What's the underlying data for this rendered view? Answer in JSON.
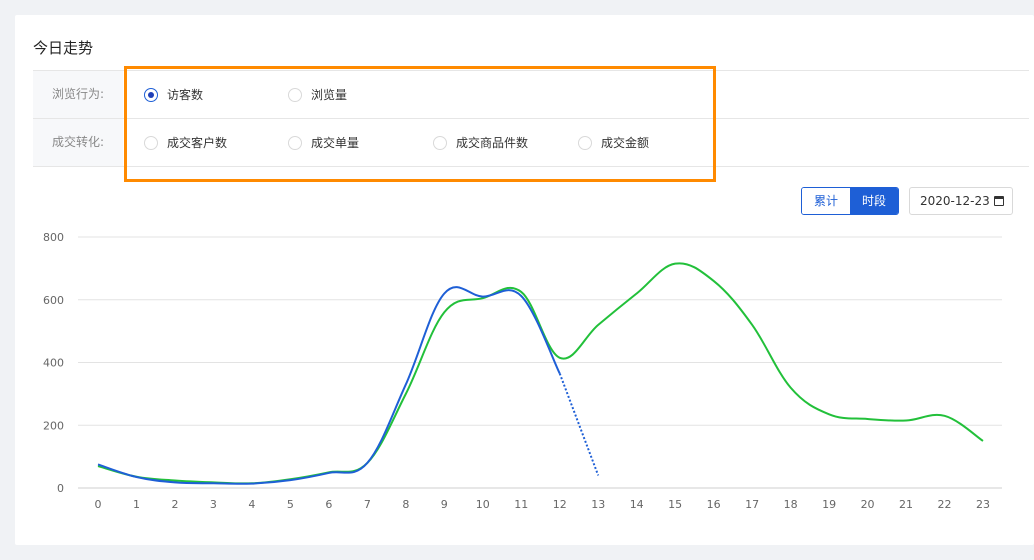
{
  "title": "今日走势",
  "filters": {
    "browse": {
      "label": "浏览行为:",
      "options": [
        {
          "label": "访客数",
          "checked": true
        },
        {
          "label": "浏览量",
          "checked": false
        }
      ]
    },
    "deal": {
      "label": "成交转化:",
      "options": [
        {
          "label": "成交客户数",
          "checked": false
        },
        {
          "label": "成交单量",
          "checked": false
        },
        {
          "label": "成交商品件数",
          "checked": false
        },
        {
          "label": "成交金额",
          "checked": false
        }
      ]
    }
  },
  "toggle": {
    "cumulative": "累计",
    "period": "时段",
    "active": "period"
  },
  "date": "2020-12-23",
  "colors": {
    "accent": "#1e5fd6",
    "highlight": "#ff8a00",
    "today": "#1e5fd6",
    "compare": "#22c03a"
  },
  "chart_data": {
    "type": "line",
    "x": [
      0,
      1,
      2,
      3,
      4,
      5,
      6,
      7,
      8,
      9,
      10,
      11,
      12,
      13,
      14,
      15,
      16,
      17,
      18,
      19,
      20,
      21,
      22,
      23
    ],
    "ylim": [
      0,
      800
    ],
    "yticks": [
      0,
      200,
      400,
      600,
      800
    ],
    "grid": true,
    "series": [
      {
        "color": "#1e5fd6",
        "values": [
          75,
          35,
          18,
          15,
          14,
          25,
          48,
          80,
          330,
          620,
          610,
          612,
          365,
          null,
          null,
          null,
          null,
          null,
          null,
          null,
          null,
          null,
          null,
          null
        ],
        "dashed_to": {
          "x": 13,
          "y": 40
        }
      },
      {
        "color": "#22c03a",
        "values": [
          70,
          36,
          24,
          18,
          15,
          28,
          50,
          80,
          300,
          560,
          605,
          625,
          415,
          520,
          620,
          715,
          660,
          520,
          320,
          235,
          220,
          215,
          230,
          150
        ]
      }
    ]
  }
}
